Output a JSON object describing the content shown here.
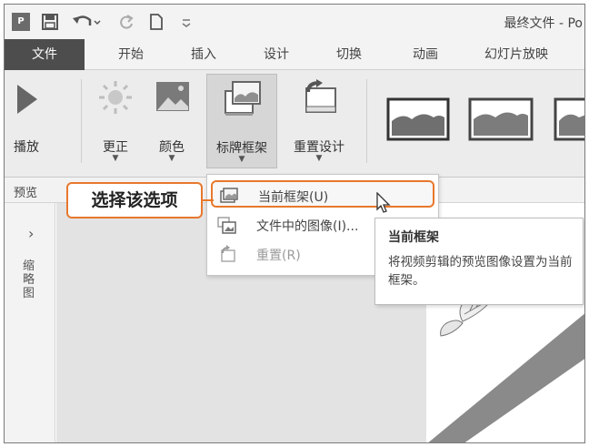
{
  "window": {
    "title": "最终文件 - Po"
  },
  "tabs": [
    {
      "label": "文件"
    },
    {
      "label": "开始"
    },
    {
      "label": "插入"
    },
    {
      "label": "设计"
    },
    {
      "label": "切换"
    },
    {
      "label": "动画"
    },
    {
      "label": "幻灯片放映"
    }
  ],
  "ribbon": {
    "play_label": "播放",
    "corrections_label": "更正",
    "color_label": "颜色",
    "poster_frame_label": "标牌框架",
    "reset_design_label": "重置设计",
    "group_preview_label": "预览"
  },
  "dropdown": {
    "items": [
      {
        "label": "当前框架(U)"
      },
      {
        "label": "文件中的图像(I)..."
      },
      {
        "label": "重置(R)"
      }
    ]
  },
  "tooltip": {
    "title": "当前框架",
    "body": "将视频剪辑的预览图像设置为当前框架。"
  },
  "callout": {
    "text": "选择该选项"
  },
  "left_panel": {
    "chevron": "›",
    "label": "缩略图"
  },
  "colors": {
    "accent_orange": "#e8782d",
    "file_tab_bg": "#4d4d4d"
  }
}
